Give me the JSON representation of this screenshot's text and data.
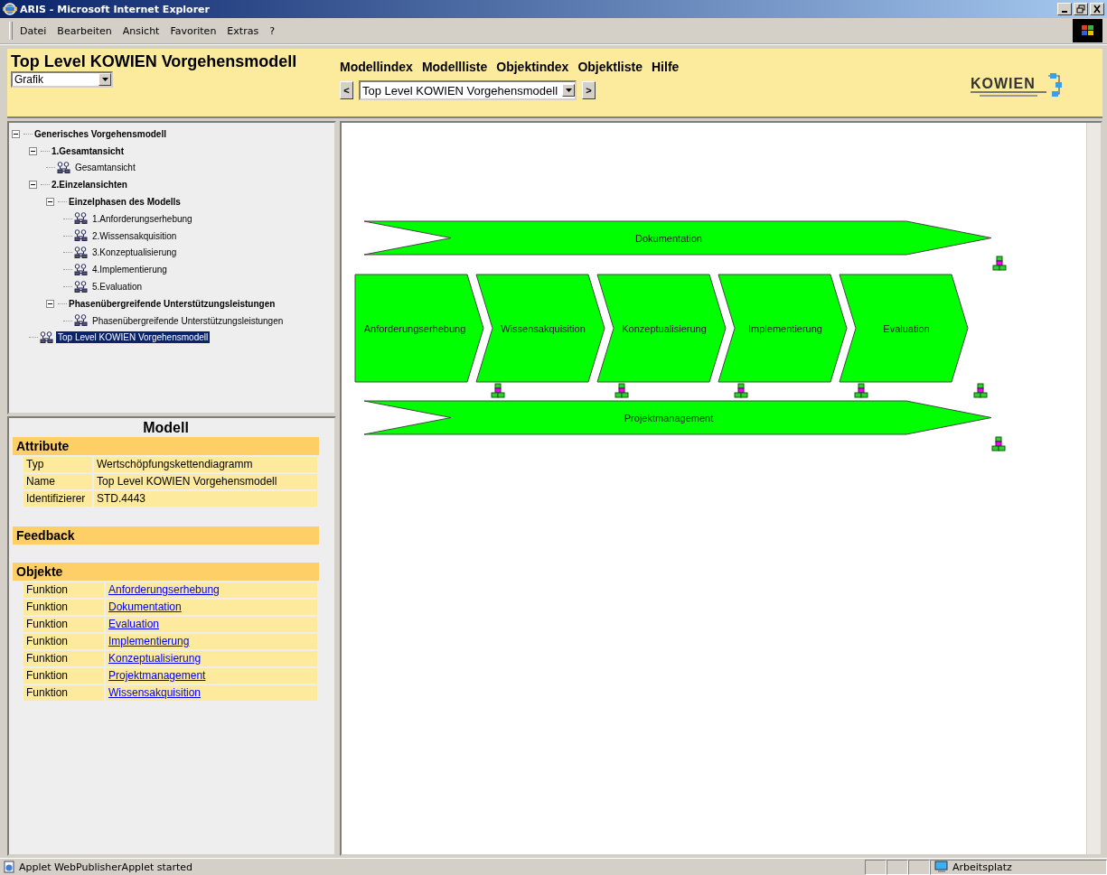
{
  "window": {
    "title": "ARIS - Microsoft Internet Explorer"
  },
  "menu": [
    "Datei",
    "Bearbeiten",
    "Ansicht",
    "Favoriten",
    "Extras",
    "?"
  ],
  "header": {
    "title": "Top Level KOWIEN Vorgehensmodell",
    "view_select": "Grafik",
    "nav_links": [
      "Modellindex",
      "Modellliste",
      "Objektindex",
      "Objektliste",
      "Hilfe"
    ],
    "prev_button": "<",
    "model_select": "Top Level KOWIEN Vorgehensmodell",
    "next_button": ">",
    "logo": "KOWIEN"
  },
  "tree": {
    "items": [
      {
        "label": "Generisches Vorgehensmodell",
        "kind": "folder",
        "expanded": true,
        "selected": false,
        "children": [
          {
            "label": "1.Gesamtansicht",
            "kind": "folder",
            "expanded": true,
            "selected": false,
            "children": [
              {
                "label": "Gesamtansicht",
                "kind": "model",
                "selected": false
              }
            ]
          },
          {
            "label": "2.Einzelansichten",
            "kind": "folder",
            "expanded": true,
            "selected": false,
            "children": [
              {
                "label": "Einzelphasen des Modells",
                "kind": "folder",
                "expanded": true,
                "selected": false,
                "children": [
                  {
                    "label": "1.Anforderungserhebung",
                    "kind": "model",
                    "selected": false
                  },
                  {
                    "label": "2.Wissensakquisition",
                    "kind": "model",
                    "selected": false
                  },
                  {
                    "label": "3.Konzeptualisierung",
                    "kind": "model",
                    "selected": false
                  },
                  {
                    "label": "4.Implementierung",
                    "kind": "model",
                    "selected": false
                  },
                  {
                    "label": "5.Evaluation",
                    "kind": "model",
                    "selected": false
                  }
                ]
              },
              {
                "label": "Phasenübergreifende Unterstützungsleistungen",
                "kind": "folder",
                "expanded": true,
                "selected": false,
                "children": [
                  {
                    "label": "Phasenübergreifende Unterstützungsleistungen",
                    "kind": "model",
                    "selected": false
                  }
                ]
              }
            ]
          },
          {
            "label": "Top Level KOWIEN Vorgehensmodell",
            "kind": "model",
            "selected": true
          }
        ]
      }
    ]
  },
  "info": {
    "heading": "Modell",
    "attributes": {
      "title": "Attribute",
      "rows": [
        {
          "key": "Typ",
          "value": "Wertschöpfungskettendiagramm"
        },
        {
          "key": "Name",
          "value": "Top Level KOWIEN Vorgehensmodell"
        },
        {
          "key": "Identifizierer",
          "value": "STD.4443"
        }
      ]
    },
    "feedback": {
      "title": "Feedback"
    },
    "objects": {
      "title": "Objekte",
      "rows": [
        {
          "type": "Funktion",
          "name": "Anforderungserhebung"
        },
        {
          "type": "Funktion",
          "name": "Dokumentation"
        },
        {
          "type": "Funktion",
          "name": "Evaluation"
        },
        {
          "type": "Funktion",
          "name": "Implementierung"
        },
        {
          "type": "Funktion",
          "name": "Konzeptualisierung"
        },
        {
          "type": "Funktion",
          "name": "Projektmanagement"
        },
        {
          "type": "Funktion",
          "name": "Wissensakquisition"
        }
      ]
    }
  },
  "diagram": {
    "shapes": [
      {
        "kind": "band",
        "label": "Dokumentation"
      },
      {
        "kind": "chevron",
        "label": "Anforderungserhebung"
      },
      {
        "kind": "chevron",
        "label": "Wissensakquisition"
      },
      {
        "kind": "chevron",
        "label": "Konzeptualisierung"
      },
      {
        "kind": "chevron",
        "label": "Implementierung"
      },
      {
        "kind": "chevron",
        "label": "Evaluation"
      },
      {
        "kind": "band",
        "label": "Projektmanagement"
      }
    ]
  },
  "status_bar": {
    "text": "Applet WebPublisherApplet started",
    "zone": "Arbeitsplatz"
  }
}
